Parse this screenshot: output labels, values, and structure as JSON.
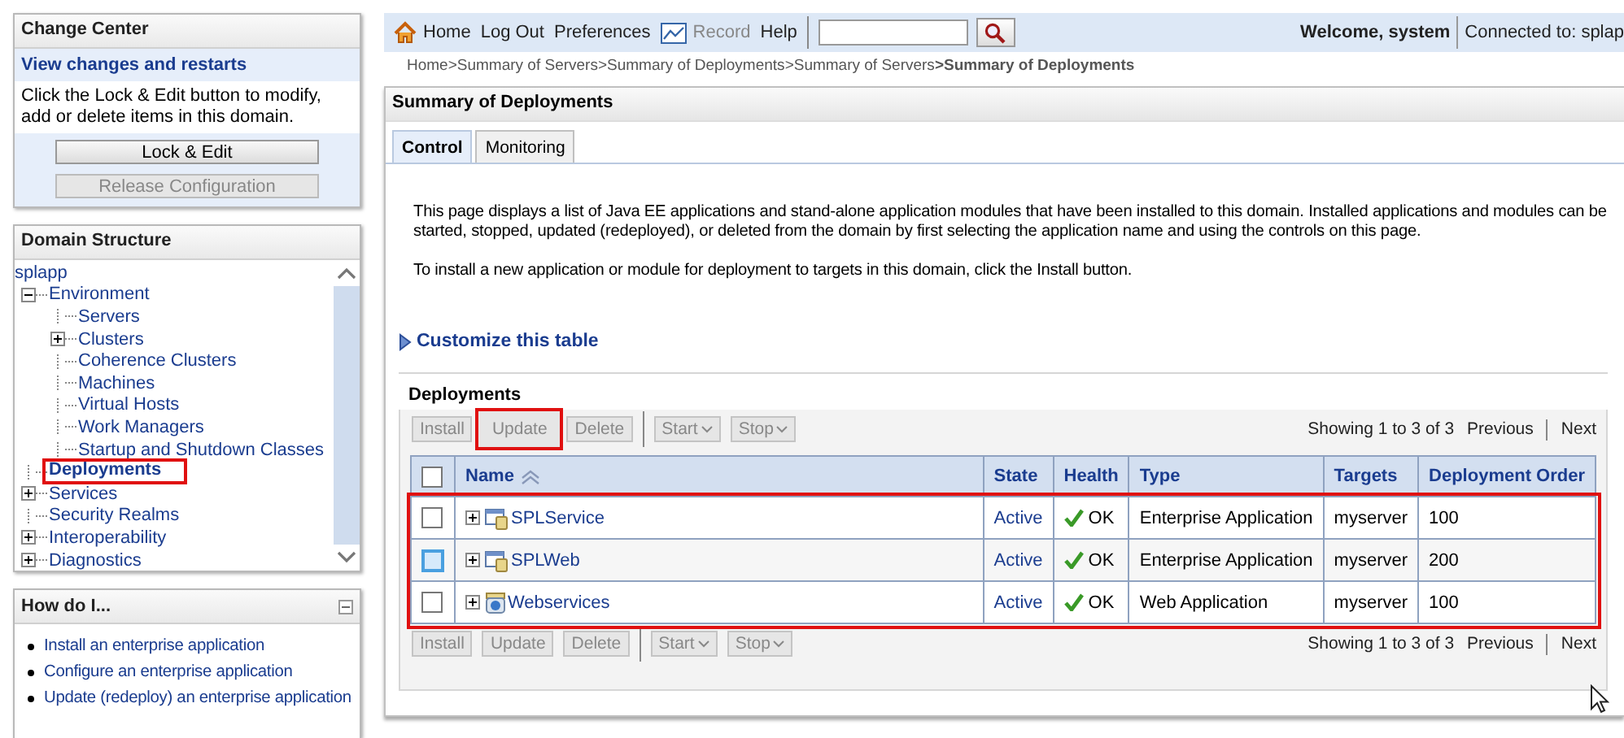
{
  "change_center": {
    "title": "Change Center",
    "link": "View changes and restarts",
    "text": "Click the Lock & Edit button to modify, add or delete items in this domain.",
    "buttons": [
      {
        "label": "Lock & Edit",
        "disabled": false
      },
      {
        "label": "Release Configuration",
        "disabled": true
      }
    ]
  },
  "domain_structure": {
    "title": "Domain Structure",
    "tree": [
      {
        "label": "splapp",
        "selected": false,
        "highlighted": false,
        "children": [
          {
            "label": "Environment",
            "expanded": true,
            "selected": false,
            "highlighted": false,
            "children": [
              {
                "label": "Servers",
                "selected": false,
                "highlighted": false
              },
              {
                "label": "Clusters",
                "expanded": false,
                "selected": false,
                "highlighted": false
              },
              {
                "label": "Coherence Clusters",
                "selected": false,
                "highlighted": false
              },
              {
                "label": "Machines",
                "selected": false,
                "highlighted": false
              },
              {
                "label": "Virtual Hosts",
                "selected": false,
                "highlighted": false
              },
              {
                "label": "Work Managers",
                "selected": false,
                "highlighted": false
              },
              {
                "label": "Startup and Shutdown Classes",
                "selected": false,
                "highlighted": false
              }
            ]
          },
          {
            "label": "Deployments",
            "selected": true,
            "highlighted": true
          },
          {
            "label": "Services",
            "expanded": false,
            "selected": false,
            "highlighted": false
          },
          {
            "label": "Security Realms",
            "selected": false,
            "highlighted": false
          },
          {
            "label": "Interoperability",
            "expanded": false,
            "selected": false,
            "highlighted": false
          },
          {
            "label": "Diagnostics",
            "expanded": false,
            "selected": false,
            "highlighted": false
          }
        ]
      }
    ]
  },
  "how_do_i": {
    "title": "How do I...",
    "items": [
      "Install an enterprise application",
      "Configure an enterprise application",
      "Update (redeploy) an enterprise application"
    ]
  },
  "top_bar": {
    "links": [
      {
        "label": "Home",
        "kind": "home",
        "disabled": false
      },
      {
        "label": "Log Out",
        "kind": "plain",
        "disabled": false
      },
      {
        "label": "Preferences",
        "kind": "plain",
        "disabled": false
      },
      {
        "label": "Record",
        "kind": "record",
        "disabled": true
      },
      {
        "label": "Help",
        "kind": "plain",
        "disabled": false
      }
    ],
    "welcome": "Welcome, system",
    "connected": "Connected to: splap"
  },
  "breadcrumb": [
    {
      "label": "Home",
      "current": false
    },
    {
      "label": ">Summary of Servers",
      "current": false
    },
    {
      "label": ">Summary of Deployments",
      "current": false
    },
    {
      "label": ">Summary of Servers",
      "current": false
    },
    {
      "label": ">Summary of Deployments",
      "current": true
    }
  ],
  "page": {
    "title": "Summary of Deployments",
    "tabs": [
      {
        "label": "Control",
        "selected": true
      },
      {
        "label": "Monitoring",
        "selected": false
      }
    ],
    "paragraphs": [
      "This page displays a list of Java EE applications and stand-alone application modules that have been installed to this domain. Installed applications and modules can be started, stopped, updated (redeployed), or deleted from the domain by first selecting the application name and using the controls on this page.",
      "To install a new application or module for deployment to targets in this domain, click the Install button."
    ],
    "customize": "Customize this table",
    "table_title": "Deployments",
    "toolbars": [
      {
        "buttons": [
          {
            "label": "Install",
            "kind": "plain",
            "highlighted": false
          },
          {
            "label": "Update",
            "kind": "plain",
            "highlighted": true
          },
          {
            "label": "Delete",
            "kind": "plain",
            "highlighted": false
          },
          {
            "label": "Start",
            "kind": "dropdown",
            "highlighted": false
          },
          {
            "label": "Stop",
            "kind": "dropdown",
            "highlighted": false
          }
        ],
        "showing": "Showing 1 to 3 of 3",
        "previous": "Previous",
        "next": "Next"
      },
      {
        "buttons": [
          {
            "label": "Install",
            "kind": "plain",
            "highlighted": false
          },
          {
            "label": "Update",
            "kind": "plain",
            "highlighted": false
          },
          {
            "label": "Delete",
            "kind": "plain",
            "highlighted": false
          },
          {
            "label": "Start",
            "kind": "dropdown",
            "highlighted": false
          },
          {
            "label": "Stop",
            "kind": "dropdown",
            "highlighted": false
          }
        ],
        "showing": "Showing 1 to 3 of 3",
        "previous": "Previous",
        "next": "Next"
      }
    ],
    "table": {
      "columns": [
        "Name",
        "State",
        "Health",
        "Type",
        "Targets",
        "Deployment Order"
      ],
      "rows_highlighted": true,
      "all_checked": false,
      "rows": [
        {
          "checked": false,
          "hovered": false,
          "kind": "enterprise",
          "name": "SPLService",
          "state": "Active",
          "health": "OK",
          "type": "Enterprise Application",
          "targets": "myserver",
          "order": "100"
        },
        {
          "checked": false,
          "hovered": true,
          "kind": "enterprise",
          "name": "SPLWeb",
          "state": "Active",
          "health": "OK",
          "type": "Enterprise Application",
          "targets": "myserver",
          "order": "200"
        },
        {
          "checked": false,
          "hovered": false,
          "kind": "web",
          "name": "Webservices",
          "state": "Active",
          "health": "OK",
          "type": "Web Application",
          "targets": "myserver",
          "order": "100"
        }
      ]
    }
  }
}
